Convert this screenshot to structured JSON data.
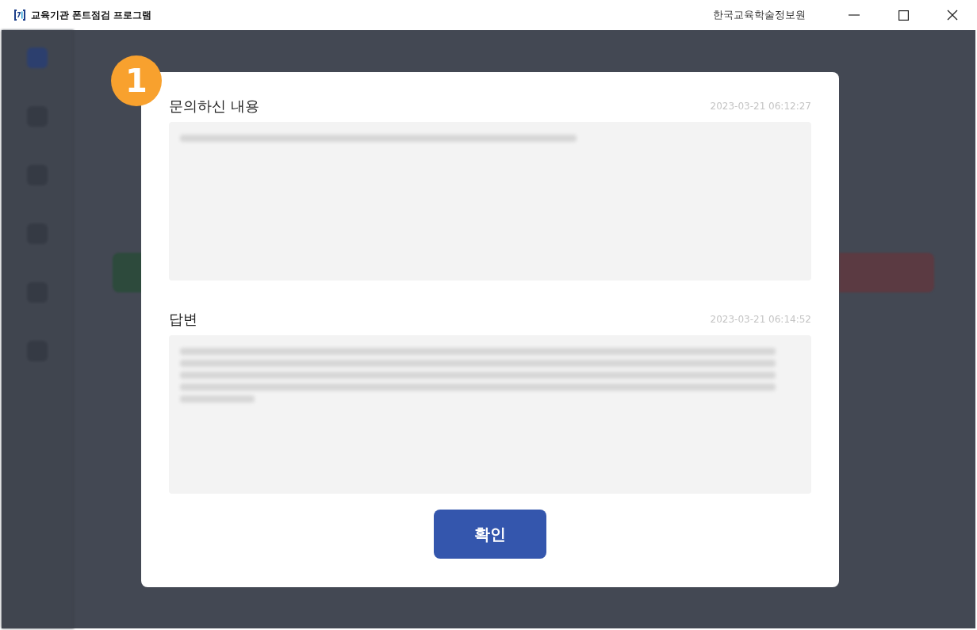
{
  "window": {
    "title": "교육기관 폰트점검 프로그램",
    "organization": "한국교육학술정보원"
  },
  "dialog": {
    "step_badge": "1",
    "sections": [
      {
        "title": "문의하신 내용",
        "date": "2023-03-21 06:12:27"
      },
      {
        "title": "답변",
        "date": "2023-03-21 06:14:52"
      }
    ],
    "confirm_button": "확인"
  }
}
